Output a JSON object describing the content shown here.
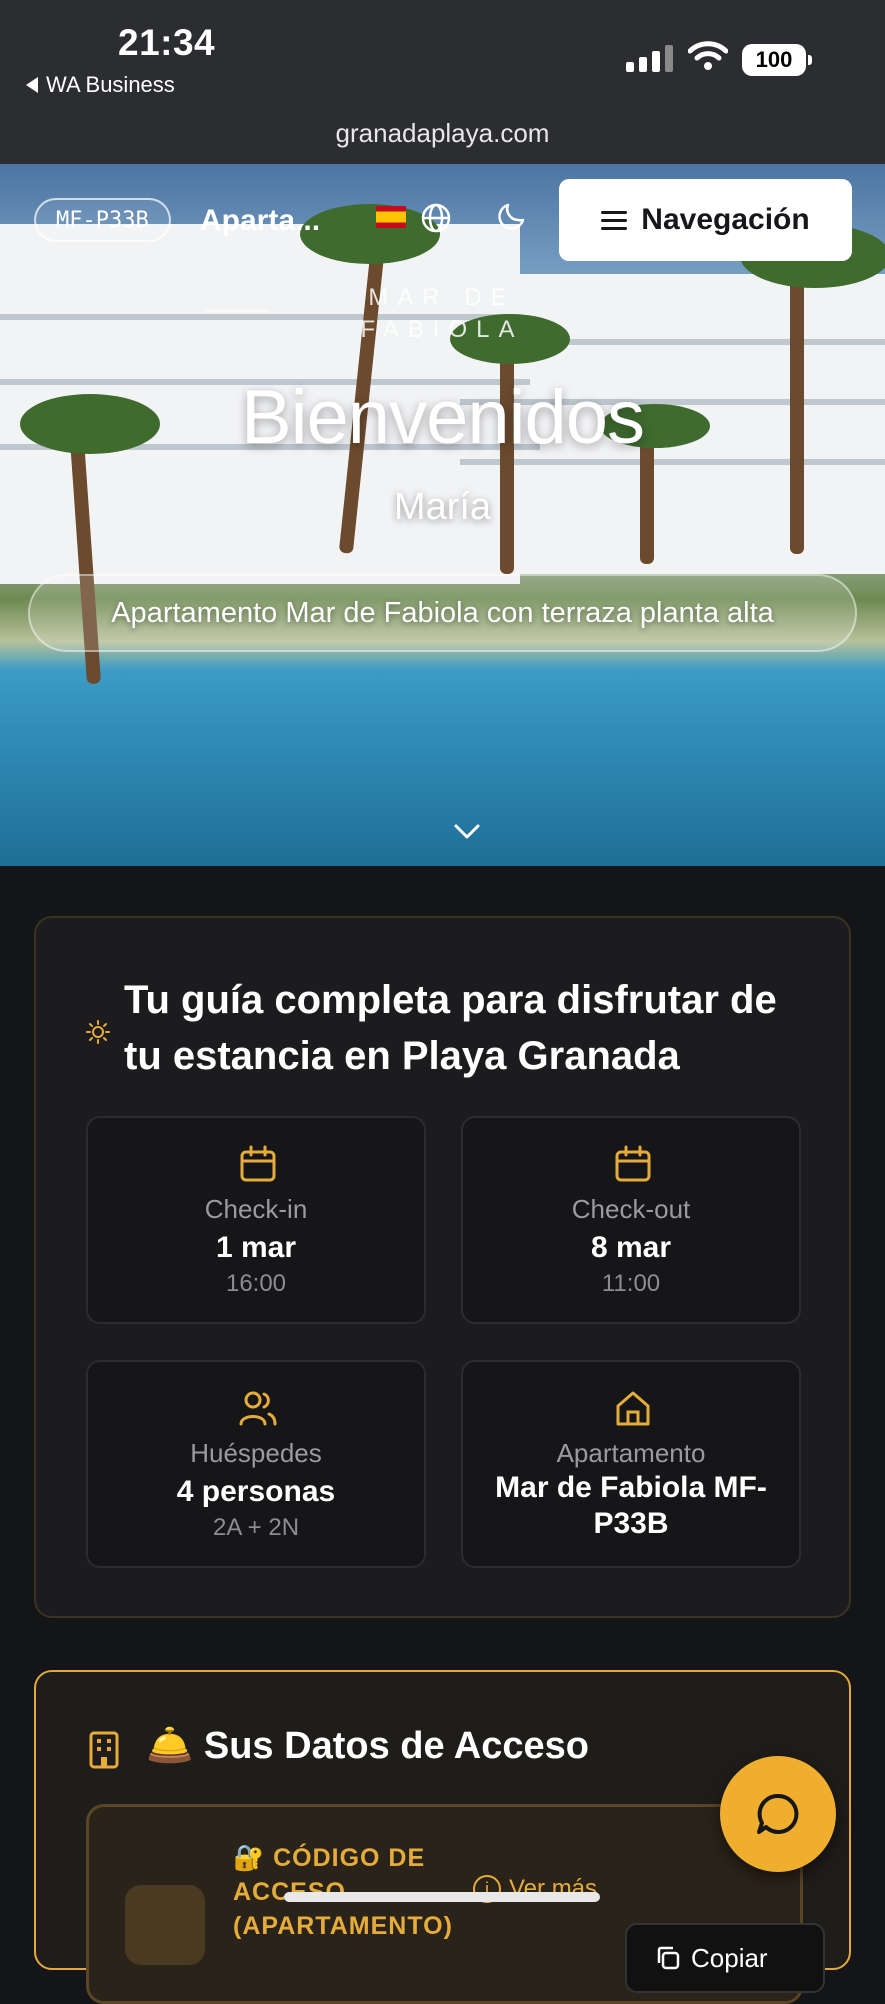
{
  "status_bar": {
    "time": "21:34",
    "back_app": "WA Business",
    "battery": "100",
    "url": "granadaplaya.com"
  },
  "hero": {
    "code": "MF-P33B",
    "apartment_short": "Aparta...",
    "nav_label": "Navegación",
    "brand": "MAR DE FABIOLA",
    "welcome": "Bienvenidos",
    "guest_name": "María",
    "apartment_full": "Apartamento Mar de Fabiola con terraza planta alta"
  },
  "guide": {
    "title": "Tu guía completa para disfrutar de tu estancia en Playa Granada",
    "tiles": [
      {
        "icon": "calendar-icon",
        "label": "Check-in",
        "value": "1 mar",
        "sub": "16:00"
      },
      {
        "icon": "calendar-icon",
        "label": "Check-out",
        "value": "8 mar",
        "sub": "11:00"
      },
      {
        "icon": "users-icon",
        "label": "Huéspedes",
        "value": "4 personas",
        "sub": "2A + 2N"
      },
      {
        "icon": "home-icon",
        "label": "Apartamento",
        "value": "Mar de Fabiola MF-P33B",
        "sub": ""
      }
    ]
  },
  "access": {
    "title": "🛎️ Sus Datos de Acceso",
    "code_label": "🔐 CÓDIGO DE ACCESO (APARTAMENTO)",
    "more_label": "Ver más",
    "copy_label": "Copiar"
  },
  "colors": {
    "accent": "#f0ae2e",
    "background": "#141519",
    "card": "#1c1c1f"
  }
}
